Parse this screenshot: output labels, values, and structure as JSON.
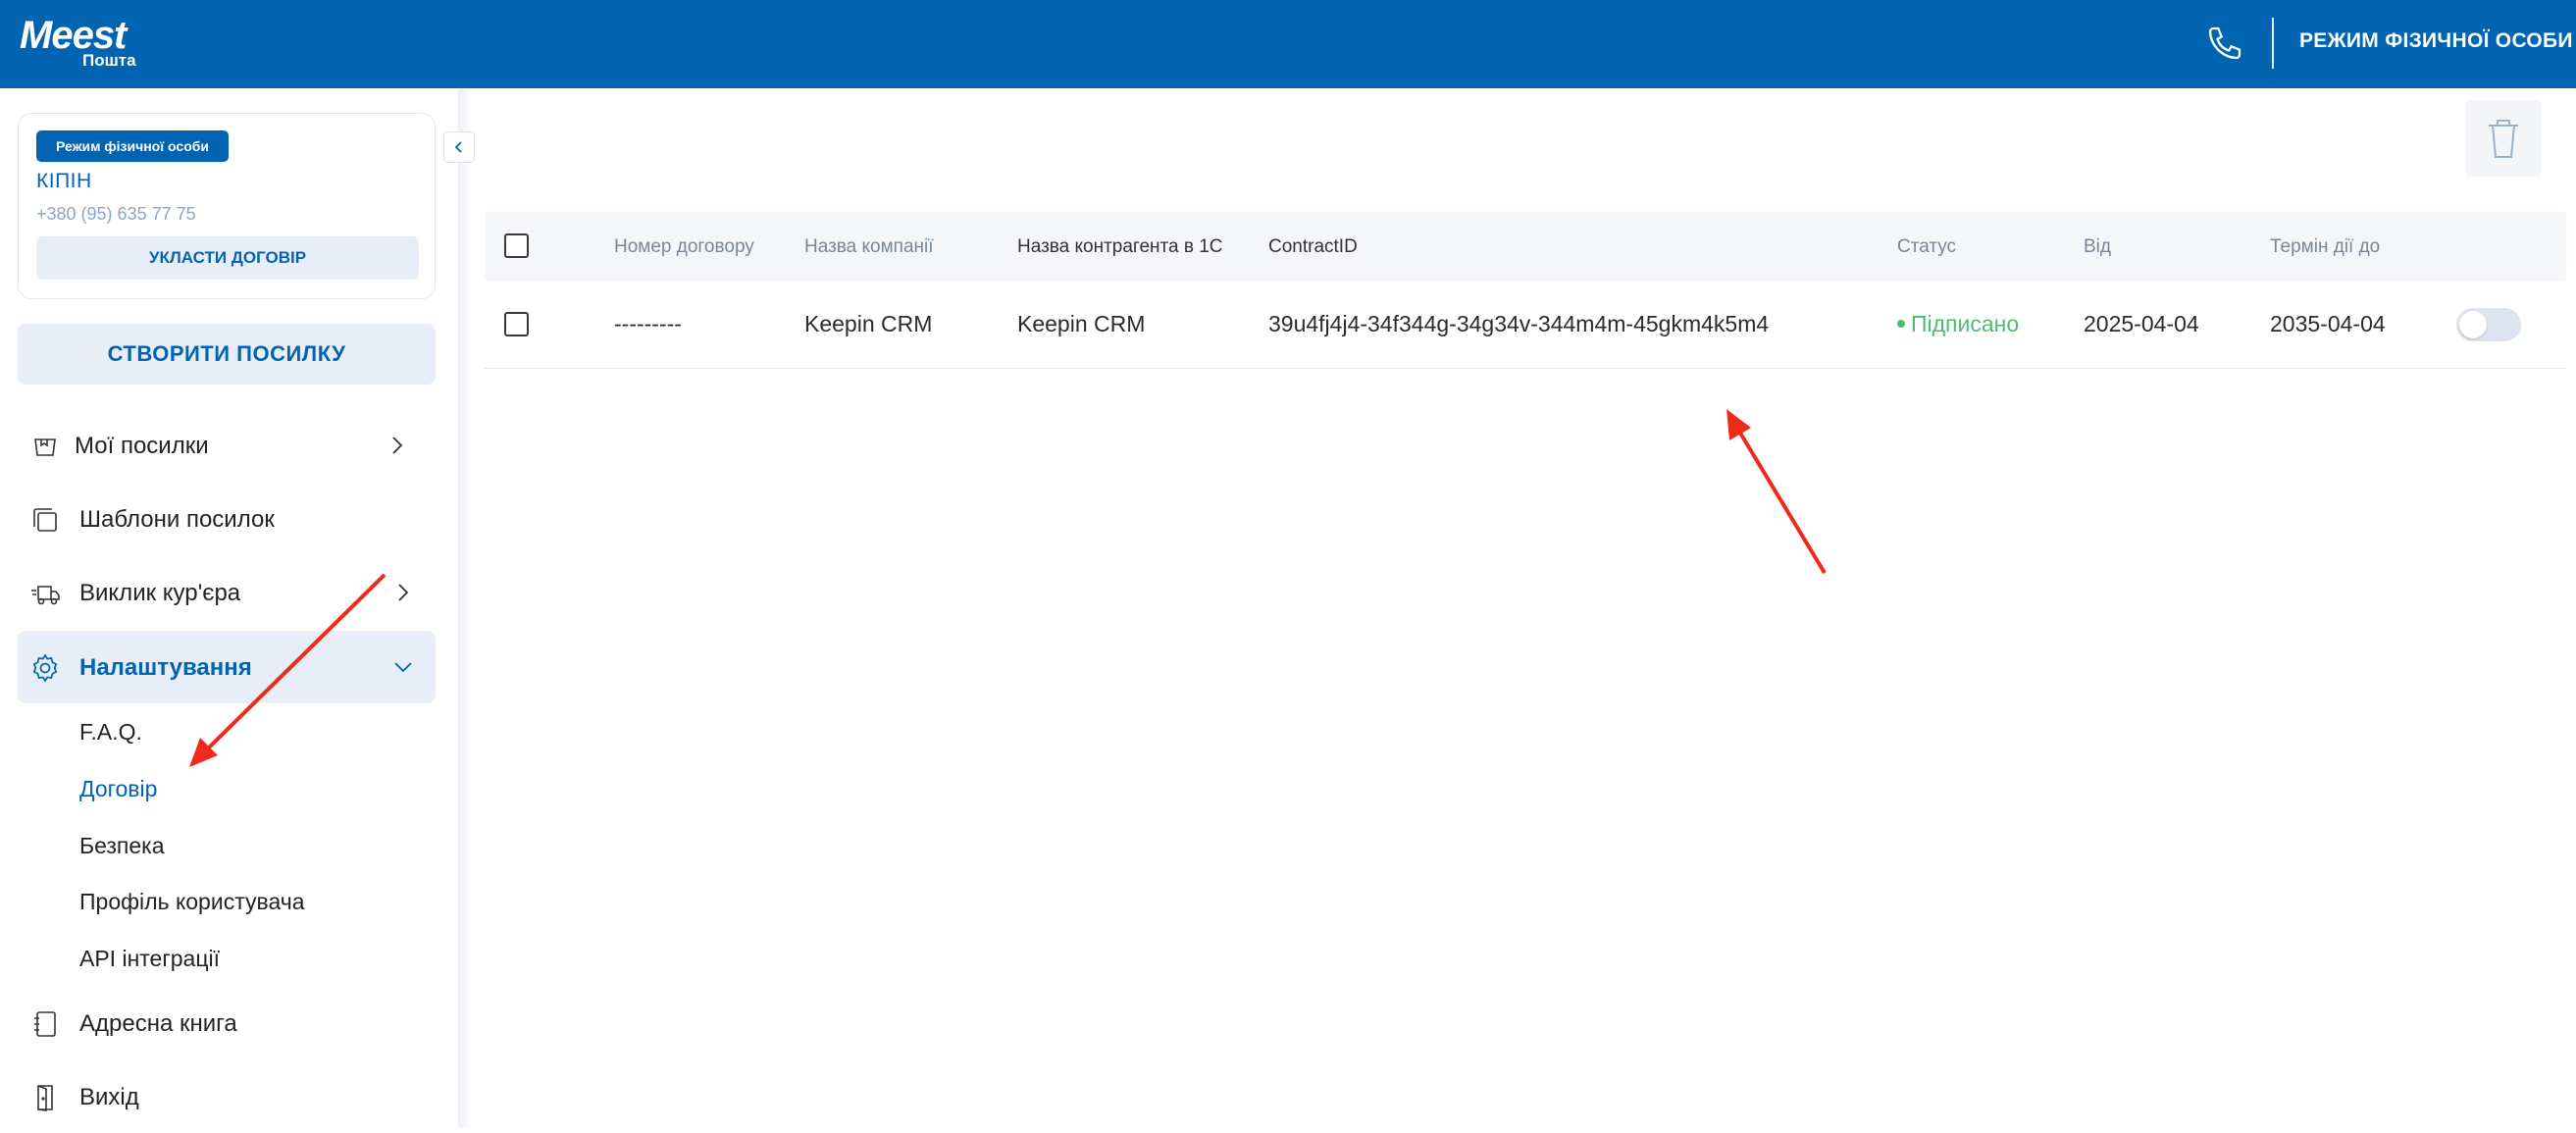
{
  "header": {
    "brand": "Meest",
    "brand_sub": "Пошта",
    "mode_label": "РЕЖИМ ФІЗИЧНОЇ ОСОБИ",
    "phone_icon": "phone-icon"
  },
  "profile_card": {
    "mode_pill": "Режим фізичної особи",
    "name": "КІПІН",
    "phone": "+380 (95) 635 77 75",
    "contract_button": "УКЛАСТИ ДОГОВІР"
  },
  "create_button": "СТВОРИТИ ПОСИЛКУ",
  "nav": {
    "items": [
      {
        "label": "Мої посилки",
        "icon": "parcel-icon"
      },
      {
        "label": "Шаблони посилок",
        "icon": "templates-icon"
      },
      {
        "label": "Виклик кур'єра",
        "icon": "courier-truck-icon"
      },
      {
        "label": "Налаштування",
        "icon": "gear-icon"
      },
      {
        "label": "Адресна книга",
        "icon": "address-book-icon"
      },
      {
        "label": "Вихід",
        "icon": "exit-icon"
      }
    ],
    "settings_sub": [
      "F.A.Q.",
      "Договір",
      "Безпека",
      "Профіль користувача",
      "API інтеграції"
    ]
  },
  "table": {
    "headers": [
      "Номер договору",
      "Назва компанії",
      "Назва контрагента в 1С",
      "ContractID",
      "Статус",
      "Від",
      "Термін дії до"
    ],
    "rows": [
      {
        "number": "---------",
        "company": "Keepin CRM",
        "counterparty": "Keepin CRM",
        "contract_id": "39u4fj4j4-34f344g-34g34v-344m4m-45gkm4k5m4",
        "status": "Підписано",
        "from": "2025-04-04",
        "until": "2035-04-04"
      }
    ]
  },
  "colors": {
    "brand_blue": "#0064b1",
    "status_green": "#4fbd70",
    "annotation_red": "#ee2b1b"
  }
}
